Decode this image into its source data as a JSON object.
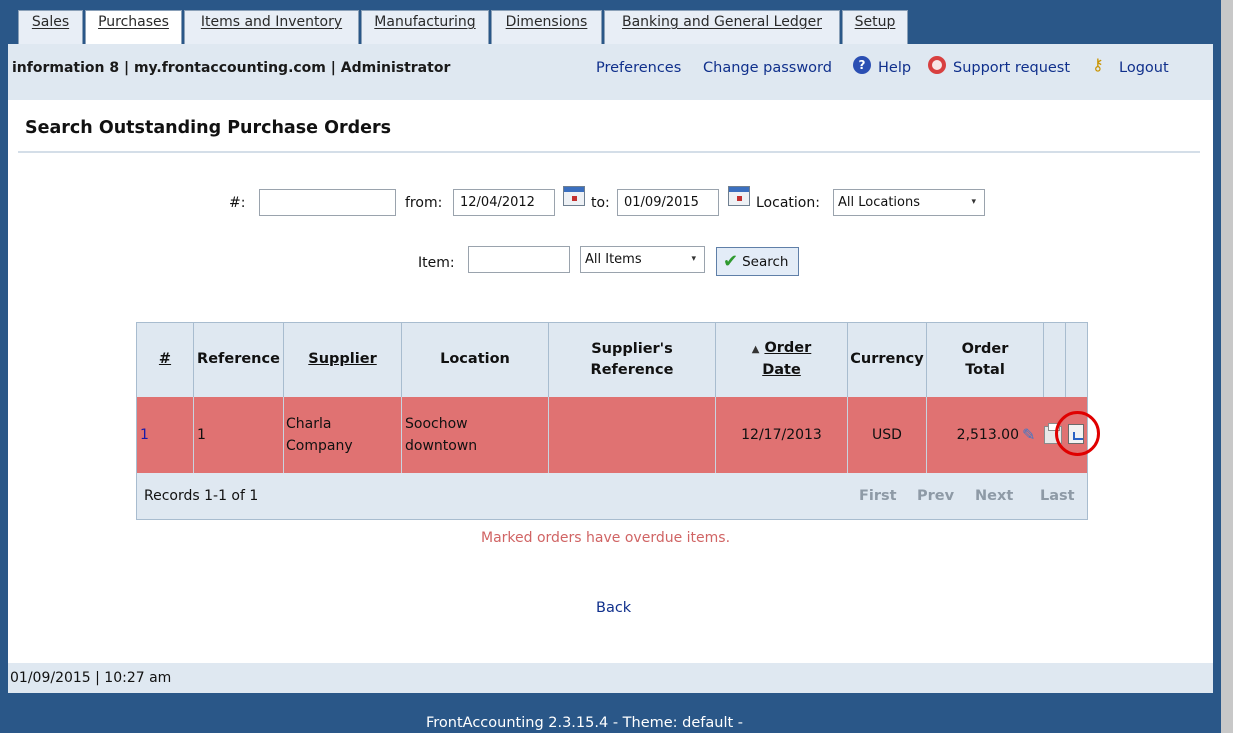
{
  "nav": {
    "tabs": [
      {
        "label": "Sales"
      },
      {
        "label": "Purchases"
      },
      {
        "label": "Items and Inventory"
      },
      {
        "label": "Manufacturing"
      },
      {
        "label": "Dimensions"
      },
      {
        "label": "Banking and General Ledger"
      },
      {
        "label": "Setup"
      }
    ],
    "active": "Purchases"
  },
  "header": {
    "company_info": "information 8 | my.frontaccounting.com | Administrator",
    "links": {
      "preferences": "Preferences",
      "change_password": "Change password",
      "help": "Help",
      "support": "Support request",
      "logout": "Logout"
    },
    "help_icon_char": "?",
    "key_icon_char": "⚷"
  },
  "page": {
    "title": "Search Outstanding Purchase Orders"
  },
  "filters": {
    "number_label": "#:",
    "number_value": "",
    "from_label": "from:",
    "from_value": "12/04/2012",
    "to_label": "to:",
    "to_value": "01/09/2015",
    "location_label": "Location:",
    "location_value": "All Locations",
    "item_label": "Item:",
    "item_value": "",
    "items_value": "All Items",
    "search_label": "Search",
    "caret": "▾",
    "check": "✔"
  },
  "table": {
    "headers": {
      "num": "#",
      "reference": "Reference",
      "supplier": "Supplier",
      "location": "Location",
      "supplier_ref_1": "Supplier's",
      "supplier_ref_2": "Reference",
      "sort_arrow": "▲",
      "order_date_1": "Order",
      "order_date_2": "Date",
      "currency": "Currency",
      "order_total_1": "Order",
      "order_total_2": "Total"
    },
    "rows": [
      {
        "num": "1",
        "reference": "1",
        "supplier_1": "Charla",
        "supplier_2": "Company",
        "location_1": "Soochow",
        "location_2": "downtown",
        "supplier_ref": "",
        "order_date": "12/17/2013",
        "currency": "USD",
        "order_total": "2,513.00",
        "overdue": true
      }
    ],
    "records_text": "Records 1-1 of 1",
    "pager": {
      "first": "First",
      "prev": "Prev",
      "next": "Next",
      "last": "Last"
    },
    "pencil_char": "✎"
  },
  "notes": {
    "overdue": "Marked orders have overdue items."
  },
  "back_link": "Back",
  "status": {
    "datetime": "01/09/2015 | 10:27 am"
  },
  "footer": {
    "version": "FrontAccounting 2.3.15.4 - Theme: default -"
  },
  "colors": {
    "frame": "#2a5788",
    "overdue_row": "#e07272",
    "link": "#10308c",
    "highlight_circle": "#e00000"
  }
}
